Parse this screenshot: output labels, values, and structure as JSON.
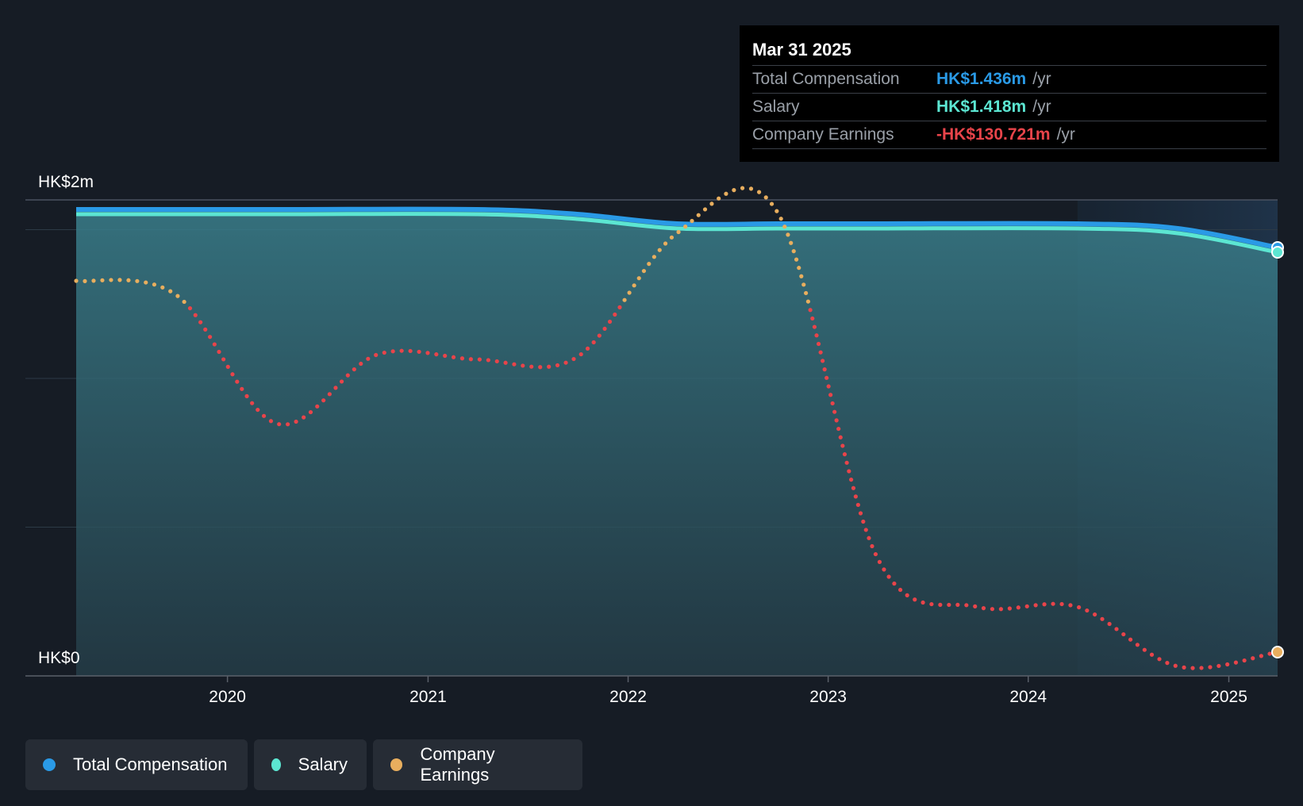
{
  "chart_data": {
    "type": "line",
    "currency_unit": "HK$",
    "y_labels": {
      "top": "HK$2m",
      "bottom": "HK$0"
    },
    "ylim": [
      0,
      2.0
    ],
    "xlim": [
      "2019-03-31",
      "2025-03-31"
    ],
    "x_ticks": [
      "2020",
      "2021",
      "2022",
      "2023",
      "2024",
      "2025"
    ],
    "grid": true,
    "legend_position": "bottom-left",
    "series": [
      {
        "name": "Total Compensation",
        "color": "#2a9ae6",
        "points": [
          [
            "2019-03-31",
            1.96
          ],
          [
            "2020-03-31",
            1.96
          ],
          [
            "2021-03-31",
            1.96
          ],
          [
            "2021-09-30",
            1.94
          ],
          [
            "2022-03-31",
            1.9
          ],
          [
            "2022-09-30",
            1.9
          ],
          [
            "2023-03-31",
            1.9
          ],
          [
            "2024-03-31",
            1.9
          ],
          [
            "2024-09-30",
            1.88
          ],
          [
            "2025-03-31",
            1.8
          ]
        ]
      },
      {
        "name": "Salary",
        "color": "#5ce6d2",
        "points": [
          [
            "2019-03-31",
            1.94
          ],
          [
            "2020-03-31",
            1.94
          ],
          [
            "2021-03-31",
            1.94
          ],
          [
            "2021-09-30",
            1.92
          ],
          [
            "2022-03-31",
            1.88
          ],
          [
            "2022-09-30",
            1.88
          ],
          [
            "2023-03-31",
            1.88
          ],
          [
            "2024-03-31",
            1.88
          ],
          [
            "2024-09-30",
            1.86
          ],
          [
            "2025-03-31",
            1.78
          ]
        ]
      },
      {
        "name": "Company Earnings",
        "color": "#e8ae5e",
        "negative_color": "#e8444a",
        "points": [
          [
            "2019-03-31",
            1.66
          ],
          [
            "2019-09-30",
            1.6
          ],
          [
            "2020-03-31",
            1.06
          ],
          [
            "2020-09-30",
            1.35
          ],
          [
            "2021-03-31",
            1.33
          ],
          [
            "2021-09-30",
            1.34
          ],
          [
            "2022-03-31",
            1.86
          ],
          [
            "2022-09-30",
            1.95
          ],
          [
            "2023-03-31",
            0.5
          ],
          [
            "2023-09-30",
            0.29
          ],
          [
            "2024-03-31",
            0.29
          ],
          [
            "2024-09-30",
            0.04
          ],
          [
            "2025-03-31",
            0.1
          ]
        ]
      }
    ]
  },
  "tooltip": {
    "date": "Mar 31 2025",
    "rows": [
      {
        "label": "Total Compensation",
        "value": "HK$1.436m",
        "unit": "/yr",
        "color": "#2a9ae6"
      },
      {
        "label": "Salary",
        "value": "HK$1.418m",
        "unit": "/yr",
        "color": "#5ce6d2"
      },
      {
        "label": "Company Earnings",
        "value": "-HK$130.721m",
        "unit": "/yr",
        "color": "#e8444a"
      }
    ]
  },
  "legend": [
    {
      "label": "Total Compensation",
      "color": "#2a9ae6"
    },
    {
      "label": "Salary",
      "color": "#5ce6d2"
    },
    {
      "label": "Company Earnings",
      "color": "#e8ae5e"
    }
  ]
}
